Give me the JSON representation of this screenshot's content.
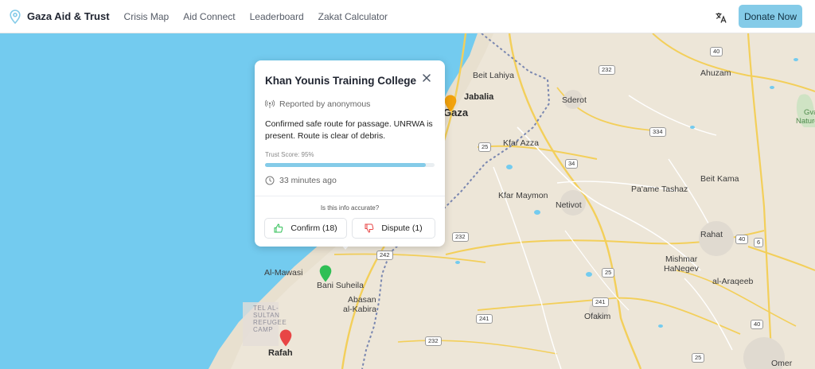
{
  "header": {
    "brand": "Gaza Aid & Trust",
    "nav": [
      "Crisis Map",
      "Aid Connect",
      "Leaderboard",
      "Zakat Calculator"
    ],
    "donate_label": "Donate Now"
  },
  "map": {
    "places": {
      "beit_lahiya": "Beit Lahiya",
      "jabalia": "Jabalia",
      "gaza": "Gaza",
      "sderot": "Sderot",
      "ahuzam": "Ahuzam",
      "kfar_azza": "Kfar Azza",
      "kfar_maymon": "Kfar Maymon",
      "netivot": "Netivot",
      "paame_tashaz": "Pa'ame Tashaz",
      "beit_kama": "Beit Kama",
      "rahat": "Rahat",
      "mishmar_line1": "Mishmar",
      "mishmar_line2": "HaNegev",
      "al_araqeeb": "al-Araqeeb",
      "al_mawasi": "Al-Mawasi",
      "bani_suheila": "Bani Suheila",
      "abasan_line1": "Abasan",
      "abasan_line2": "al-Kabira",
      "ofakim": "Ofakim",
      "rafah": "Rafah",
      "omer": "Omer",
      "camp_line1": "TEL AL-",
      "camp_line2": "SULTAN",
      "camp_line3": "REFUGEE",
      "camp_line4": "CAMP",
      "nature_line1": "Gva",
      "nature_line2": "Nature"
    },
    "road_shields": {
      "r232a": "232",
      "r232b": "232",
      "r232c": "232",
      "r34a": "34",
      "r34b": "34",
      "r334": "334",
      "r25a": "25",
      "r25b": "25",
      "r25c": "25",
      "r40a": "40",
      "r40b": "40",
      "r40c": "40",
      "r6": "6",
      "r241a": "241",
      "r241b": "241",
      "r242": "242"
    },
    "markers": [
      {
        "name": "orange",
        "color": "#f2a20c"
      },
      {
        "name": "green",
        "color": "#2fbf55"
      },
      {
        "name": "red",
        "color": "#e84545"
      }
    ]
  },
  "popup": {
    "title": "Khan Younis Training College",
    "reporter": "Reported by anonymous",
    "description": "Confirmed safe route for passage. UNRWA is present. Route is clear of debris.",
    "trust_label": "Trust Score: 95%",
    "trust_score": 0.95,
    "time": "33 minutes ago",
    "question": "Is this info accurate?",
    "confirm_label": "Confirm (18)",
    "dispute_label": "Dispute (1)"
  },
  "colors": {
    "accent": "#84cbe8",
    "sea": "#73cbef",
    "land": "#ede6d8",
    "road": "#f3cf5a",
    "confirm": "#2fbf55",
    "dispute": "#e84545"
  }
}
